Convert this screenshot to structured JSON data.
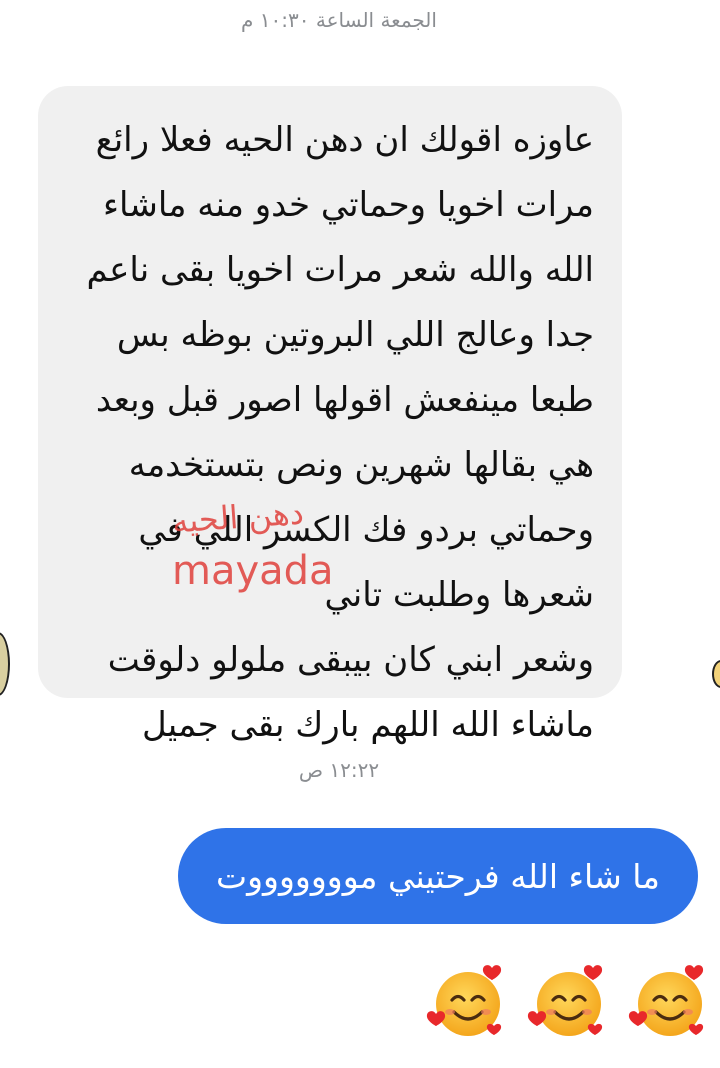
{
  "chat": {
    "top_timestamp": "الجمعة الساعة ١٠:٣٠ م",
    "incoming_message_lines": [
      "عاوزه اقولك ان دهن الحيه فعلا رائع",
      "مرات اخويا وحماتي خدو منه ماشاء",
      "الله والله شعر مرات اخويا بقى ناعم",
      "جدا وعالج اللي البروتين بوظه بس",
      "طبعا مينفعش اقولها اصور قبل وبعد",
      "هي بقالها شهرين ونص بتستخدمه",
      "وحماتي بردو فك الكسر اللي في",
      "شعرها  وطلبت تاني",
      "وشعر ابني كان بيبقى ملولو دلوقت",
      "ماشاء الله اللهم بارك بقى جميل"
    ],
    "watermark_arabic": "دهن الحيه",
    "watermark_latin": "mayada",
    "reply_timestamp": "١٢:٢٢ ص",
    "outgoing_message": "ما شاء الله فرحتيني موووووووت",
    "reaction_emojis": [
      "smiling-face-with-hearts-icon",
      "smiling-face-with-hearts-icon",
      "smiling-face-with-hearts-icon"
    ]
  },
  "colors": {
    "incoming_bubble": "#f0f0f0",
    "outgoing_bubble": "#2f73e8",
    "timestamp_text": "#8a8d91",
    "watermark": "#e0413c"
  }
}
